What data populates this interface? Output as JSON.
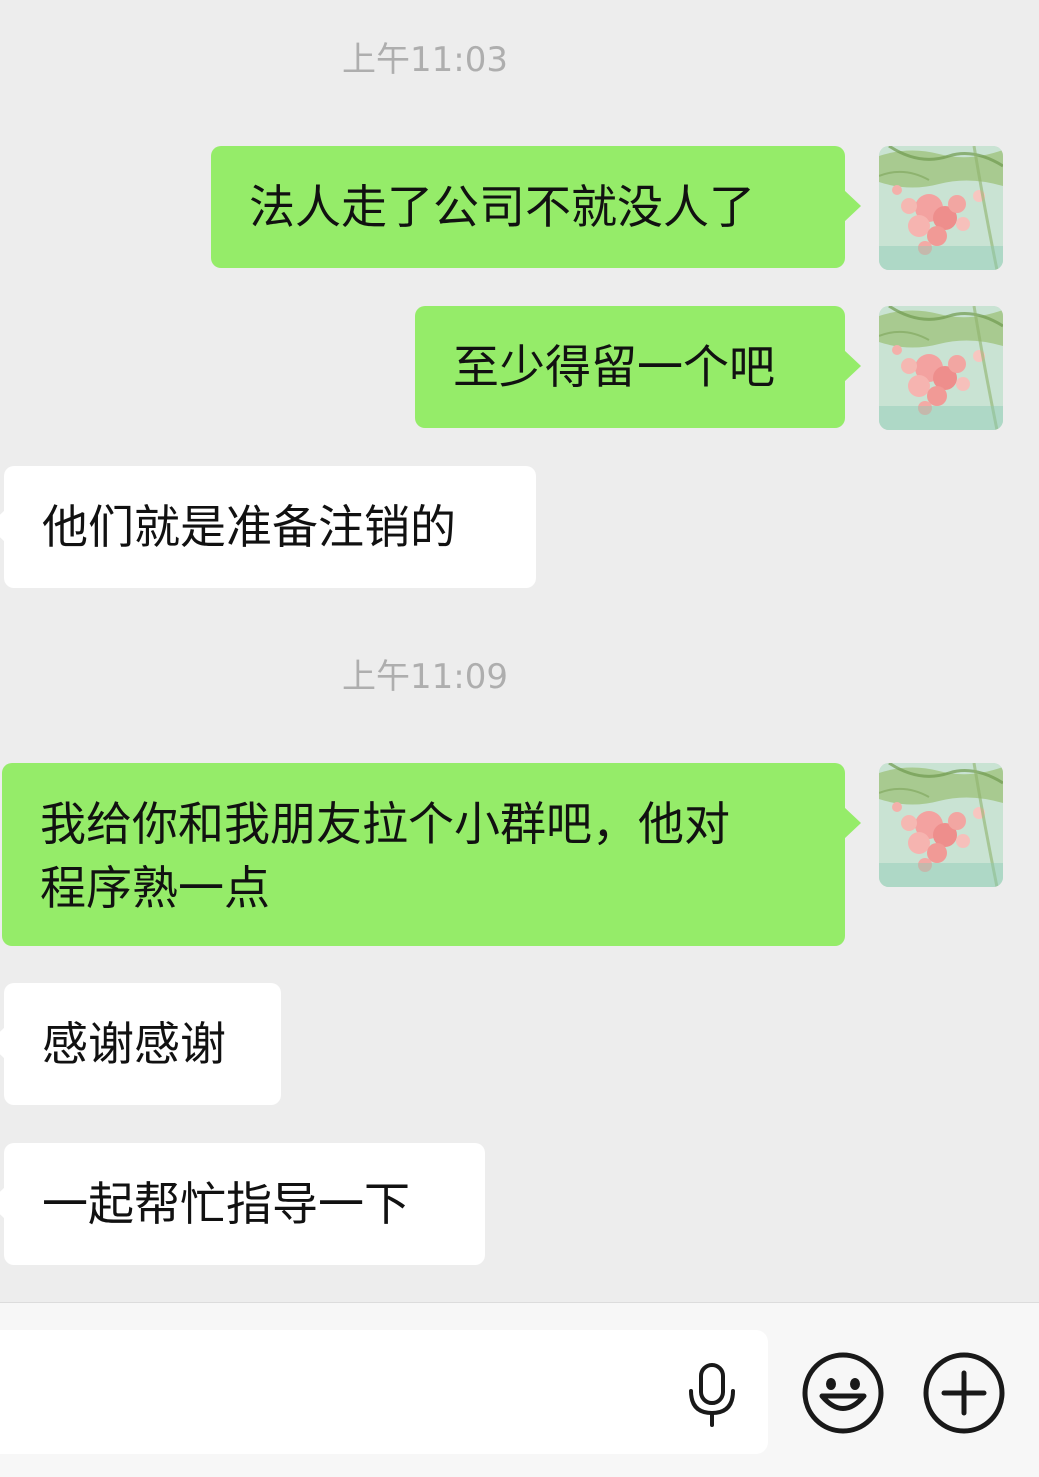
{
  "chat": {
    "timestamps": [
      "上午11:03",
      "上午11:09"
    ],
    "messages": [
      {
        "from": "me",
        "text": "法人走了公司不就没人了"
      },
      {
        "from": "me",
        "text": "至少得留一个吧"
      },
      {
        "from": "them",
        "text": "他们就是准备注销的"
      },
      {
        "from": "me",
        "line1": "我给你和我朋友拉个小群吧，他对",
        "line2": "程序熟一点"
      },
      {
        "from": "them",
        "text": "感谢感谢"
      },
      {
        "from": "them",
        "text": "一起帮忙指导一下"
      }
    ]
  },
  "input_bar": {
    "text_value": "",
    "icons": [
      "microphone-icon",
      "emoji-icon",
      "plus-icon"
    ]
  },
  "colors": {
    "background": "#ededed",
    "bubble_outgoing": "#95ec69",
    "bubble_incoming": "#ffffff",
    "timestamp": "#aeaeae",
    "input_bar": "#f7f7f7",
    "icon": "#191919"
  }
}
